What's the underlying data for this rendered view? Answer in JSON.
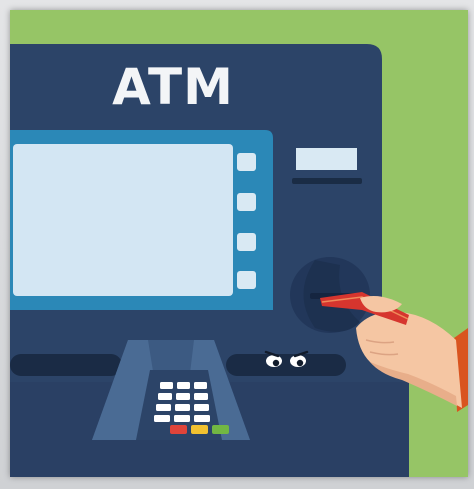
{
  "sign": {
    "text": "ATM"
  },
  "colors": {
    "background": "#96c566",
    "atm_body": "#2c4468",
    "atm_body_dark": "#223957",
    "screen_bezel": "#2b88b7",
    "screen": "#d3e6f3",
    "buttons": "#d9e9f3",
    "sign_text": "#f3f5f7",
    "card": "#d6352e",
    "hand": "#f5c6a3",
    "sleeve": "#d9541f",
    "keypad_keys": "#ffffff",
    "key_red": "#e0443a",
    "key_yellow": "#f2c230",
    "key_green": "#72b743"
  },
  "keypad": {
    "rows": 4,
    "columns": 3
  }
}
